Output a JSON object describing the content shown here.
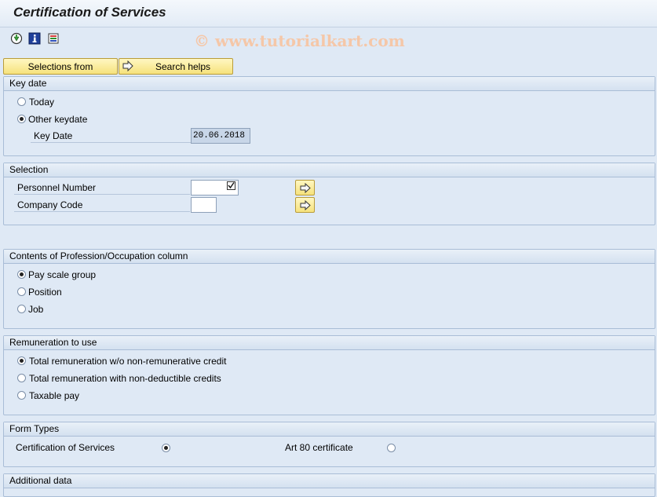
{
  "window": {
    "title": "Certification of Services"
  },
  "watermark": "© www.tutorialkart.com",
  "toolbar": {
    "icons": [
      "execute-icon",
      "info-icon",
      "program-icon"
    ]
  },
  "buttons": {
    "selections_from": "Selections from",
    "search_helps": "Search helps"
  },
  "key_date_group": {
    "title": "Key date",
    "today_label": "Today",
    "other_keydate_label": "Other keydate",
    "selected": "Other keydate",
    "key_date_label": "Key Date",
    "key_date_value": "20.06.2018"
  },
  "selection_group": {
    "title": "Selection",
    "personnel_number_label": "Personnel Number",
    "personnel_number_value": "",
    "company_code_label": "Company Code",
    "company_code_value": ""
  },
  "profession_group": {
    "title": "Contents of Profession/Occupation column",
    "options": [
      "Pay scale group",
      "Position",
      "Job"
    ],
    "selected": "Pay scale group"
  },
  "remuneration_group": {
    "title": "Remuneration to use",
    "options": [
      "Total remuneration w/o non-remunerative credit",
      "Total remuneration with non-deductible credits",
      "Taxable pay"
    ],
    "selected": "Total remuneration w/o non-remunerative credit"
  },
  "form_types_group": {
    "title": "Form Types",
    "option1": "Certification of Services",
    "option2": "Art 80 certificate",
    "selected": "Certification of Services"
  },
  "additional_group": {
    "title": "Additional data"
  }
}
